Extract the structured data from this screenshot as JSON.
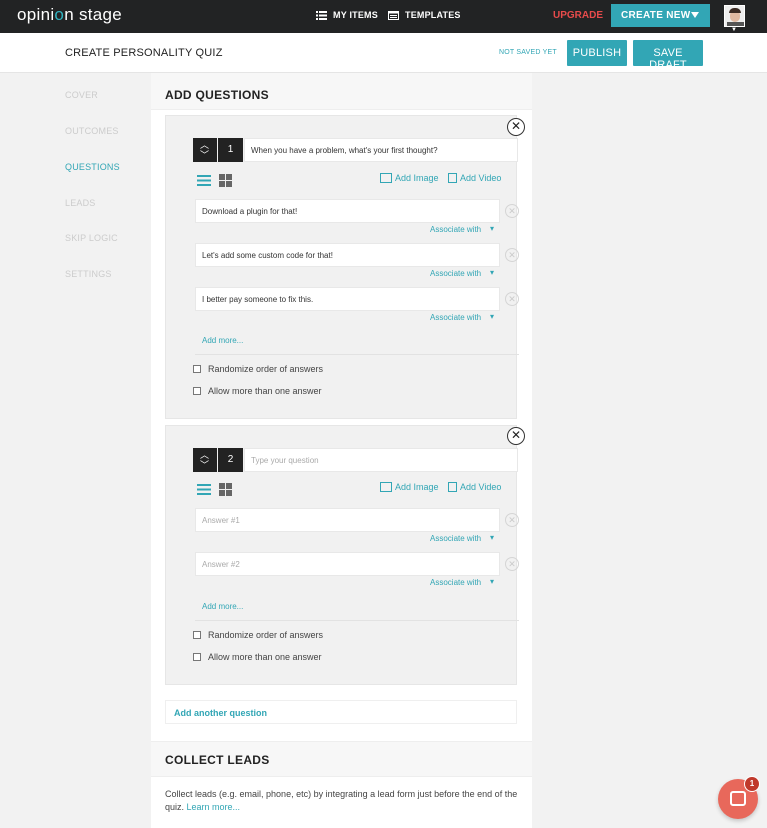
{
  "topbar": {
    "logo_main": "opini",
    "logo_dot": "o",
    "logo_rest": "n stage",
    "my_items": "MY ITEMS",
    "templates": "TEMPLATES",
    "upgrade": "UPGRADE",
    "create_new": "CREATE NEW"
  },
  "subbar": {
    "title": "CREATE PERSONALITY QUIZ",
    "status": "NOT SAVED YET",
    "publish": "PUBLISH",
    "save_draft": "SAVE DRAFT"
  },
  "sidebar": {
    "items": [
      {
        "label": "COVER"
      },
      {
        "label": "OUTCOMES"
      },
      {
        "label": "QUESTIONS"
      },
      {
        "label": "LEADS"
      },
      {
        "label": "SKIP LOGIC"
      },
      {
        "label": "SETTINGS"
      }
    ]
  },
  "add_questions": {
    "heading": "ADD QUESTIONS",
    "add_image": "Add Image",
    "add_video": "Add Video",
    "associate_with": "Associate with",
    "add_more": "Add more...",
    "randomize": "Randomize order of answers",
    "allow_multiple": "Allow more than one answer",
    "questions": [
      {
        "number": "1",
        "text": "When you have a problem, what's your first thought?",
        "answers": [
          "Download a plugin for that!",
          "Let's add some custom code for that!",
          "I better pay someone to fix this."
        ]
      },
      {
        "number": "2",
        "placeholder": "Type your question",
        "answer_placeholders": [
          "Answer #1",
          "Answer #2"
        ]
      }
    ],
    "add_another": "Add another question"
  },
  "collect_leads": {
    "heading": "COLLECT LEADS",
    "description": "Collect leads (e.g. email, phone, etc) by integrating a lead form just before the end of the quiz.",
    "learn_more": "Learn more..."
  },
  "chat": {
    "badge": "1"
  },
  "colors": {
    "accent": "#32a6b5",
    "topbar": "#222324",
    "upgrade": "#e74b4b",
    "chat": "#e8685b"
  }
}
